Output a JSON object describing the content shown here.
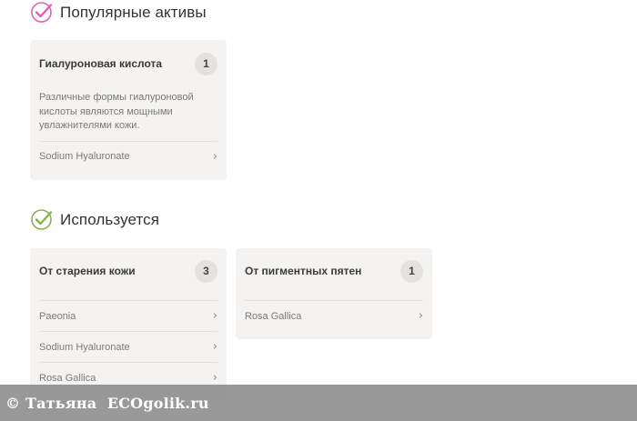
{
  "sections": [
    {
      "title": "Популярные активы",
      "check_color": "#e15fb4",
      "cards": [
        {
          "title": "Гиалуроновая кислота",
          "count": "1",
          "description": "Различные формы гиалуроновой кислоты являются мощными увлажнителями кожи.",
          "items": [
            "Sodium Hyaluronate"
          ]
        }
      ]
    },
    {
      "title": "Используется",
      "check_color": "#86b44a",
      "cards": [
        {
          "title": "От старения кожи",
          "count": "3",
          "items": [
            "Paeonia",
            "Sodium Hyaluronate",
            "Rosa Gallica"
          ]
        },
        {
          "title": "От пигментных пятен",
          "count": "1",
          "items": [
            "Rosa Gallica"
          ]
        }
      ]
    }
  ],
  "watermark": {
    "text": "© Татьяна  ECOgolik.ru"
  }
}
